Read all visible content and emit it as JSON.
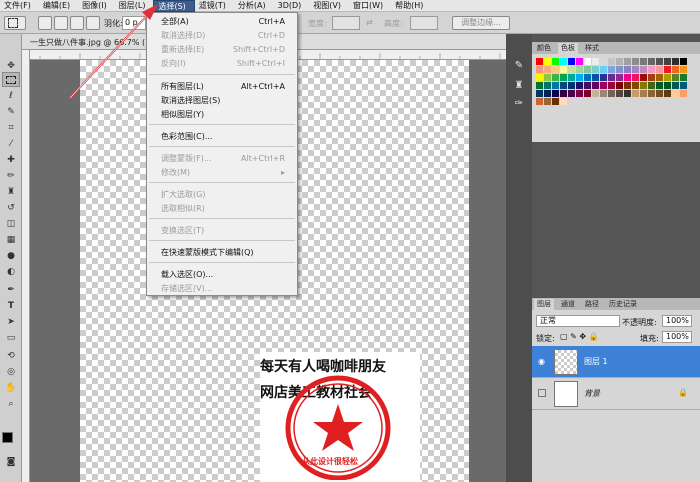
{
  "menubar": {
    "items": [
      "文件(F)",
      "编辑(E)",
      "图像(I)",
      "图层(L)",
      "选择(S)",
      "滤镜(T)",
      "分析(A)",
      "3D(D)",
      "视图(V)",
      "窗口(W)",
      "帮助(H)"
    ]
  },
  "options": {
    "feather_label": "羽化:",
    "feather_value": "0 p",
    "width_label": "宽度:",
    "height_label": "高度:",
    "refine_label": "调整边缘..."
  },
  "document": {
    "tab_title": "一生只做八件事.jpg @ 66.7% (",
    "stamp_line1": "每天有人喝咖啡朋友",
    "stamp_line2": "网店美工教材社会",
    "seal_text": "从此设计很轻松"
  },
  "select_menu": {
    "items": [
      {
        "label": "全部(A)",
        "shortcut": "Ctrl+A",
        "enabled": true
      },
      {
        "label": "取消选择(D)",
        "shortcut": "Ctrl+D",
        "enabled": false
      },
      {
        "label": "重新选择(E)",
        "shortcut": "Shift+Ctrl+D",
        "enabled": false
      },
      {
        "label": "反向(I)",
        "shortcut": "Shift+Ctrl+I",
        "enabled": false
      },
      {
        "label": "所有图层(L)",
        "shortcut": "Alt+Ctrl+A",
        "enabled": true
      },
      {
        "label": "取消选择图层(S)",
        "shortcut": "",
        "enabled": true
      },
      {
        "label": "相似图层(Y)",
        "shortcut": "",
        "enabled": true
      },
      {
        "label": "色彩范围(C)...",
        "shortcut": "",
        "enabled": true
      },
      {
        "label": "调整蒙版(F)...",
        "shortcut": "Alt+Ctrl+R",
        "enabled": false
      },
      {
        "label": "修改(M)",
        "shortcut": "▸",
        "enabled": false
      },
      {
        "label": "扩大选取(G)",
        "shortcut": "",
        "enabled": false
      },
      {
        "label": "选取相似(R)",
        "shortcut": "",
        "enabled": false
      },
      {
        "label": "变换选区(T)",
        "shortcut": "",
        "enabled": false
      },
      {
        "label": "在快速蒙版模式下编辑(Q)",
        "shortcut": "",
        "enabled": true
      },
      {
        "label": "载入选区(O)...",
        "shortcut": "",
        "enabled": true
      },
      {
        "label": "存储选区(V)...",
        "shortcut": "",
        "enabled": false
      }
    ]
  },
  "swatches": {
    "tabs": [
      "颜色",
      "色板",
      "样式"
    ],
    "colors": [
      "#ff0000",
      "#ffff00",
      "#00ff00",
      "#00ffff",
      "#0000ff",
      "#ff00ff",
      "#ffffff",
      "#ececec",
      "#d9d9d9",
      "#c6c6c6",
      "#b3b3b3",
      "#a0a0a0",
      "#8d8d8d",
      "#7a7a7a",
      "#676767",
      "#545454",
      "#414141",
      "#2e2e2e",
      "#000000",
      "#f7977a",
      "#f9ad81",
      "#fdc68a",
      "#fff79a",
      "#c4df9b",
      "#a3d39c",
      "#82ca9d",
      "#7bcdc8",
      "#6ecff6",
      "#7ea7d8",
      "#8493ca",
      "#8882be",
      "#a187be",
      "#bc8dbf",
      "#f49ac2",
      "#f6989d",
      "#ed1c24",
      "#f26522",
      "#f7941d",
      "#fff200",
      "#8dc63f",
      "#39b54a",
      "#00a651",
      "#00a99d",
      "#00aeef",
      "#0072bc",
      "#0054a6",
      "#2e3192",
      "#662d91",
      "#92278f",
      "#ec008c",
      "#ed145b",
      "#9e0b0f",
      "#a0410d",
      "#a36209",
      "#aba000",
      "#598527",
      "#1a7b30",
      "#007236",
      "#00746b",
      "#0076a3",
      "#004b80",
      "#003471",
      "#1b1464",
      "#440e62",
      "#630460",
      "#9e005d",
      "#9e0039",
      "#790000",
      "#7b2e00",
      "#7d4900",
      "#827b00",
      "#406618",
      "#005e20",
      "#005826",
      "#005952",
      "#005b7f",
      "#003663",
      "#002157",
      "#0d004c",
      "#32004b",
      "#4b0049",
      "#7b0046",
      "#7a0026",
      "#c7b299",
      "#998675",
      "#736357",
      "#534741",
      "#37302d",
      "#c69c6d",
      "#a67c52",
      "#8c6239",
      "#754c24",
      "#603913",
      "#ffcc99",
      "#ff9966",
      "#cc6633",
      "#996633",
      "#663300",
      "#ffddbb"
    ]
  },
  "layers": {
    "tabs": [
      "图层",
      "通道",
      "路径",
      "历史记录"
    ],
    "blend_mode": "正常",
    "opacity_label": "不透明度:",
    "opacity_value": "100%",
    "lock_label": "锁定:",
    "fill_label": "填充:",
    "fill_value": "100%",
    "rows": [
      {
        "name": "图层 1",
        "selected": true
      },
      {
        "name": "背景",
        "selected": false
      }
    ]
  },
  "colors": {
    "highlight": "#3d82d6",
    "annotation_arrow": "#e0303a"
  }
}
